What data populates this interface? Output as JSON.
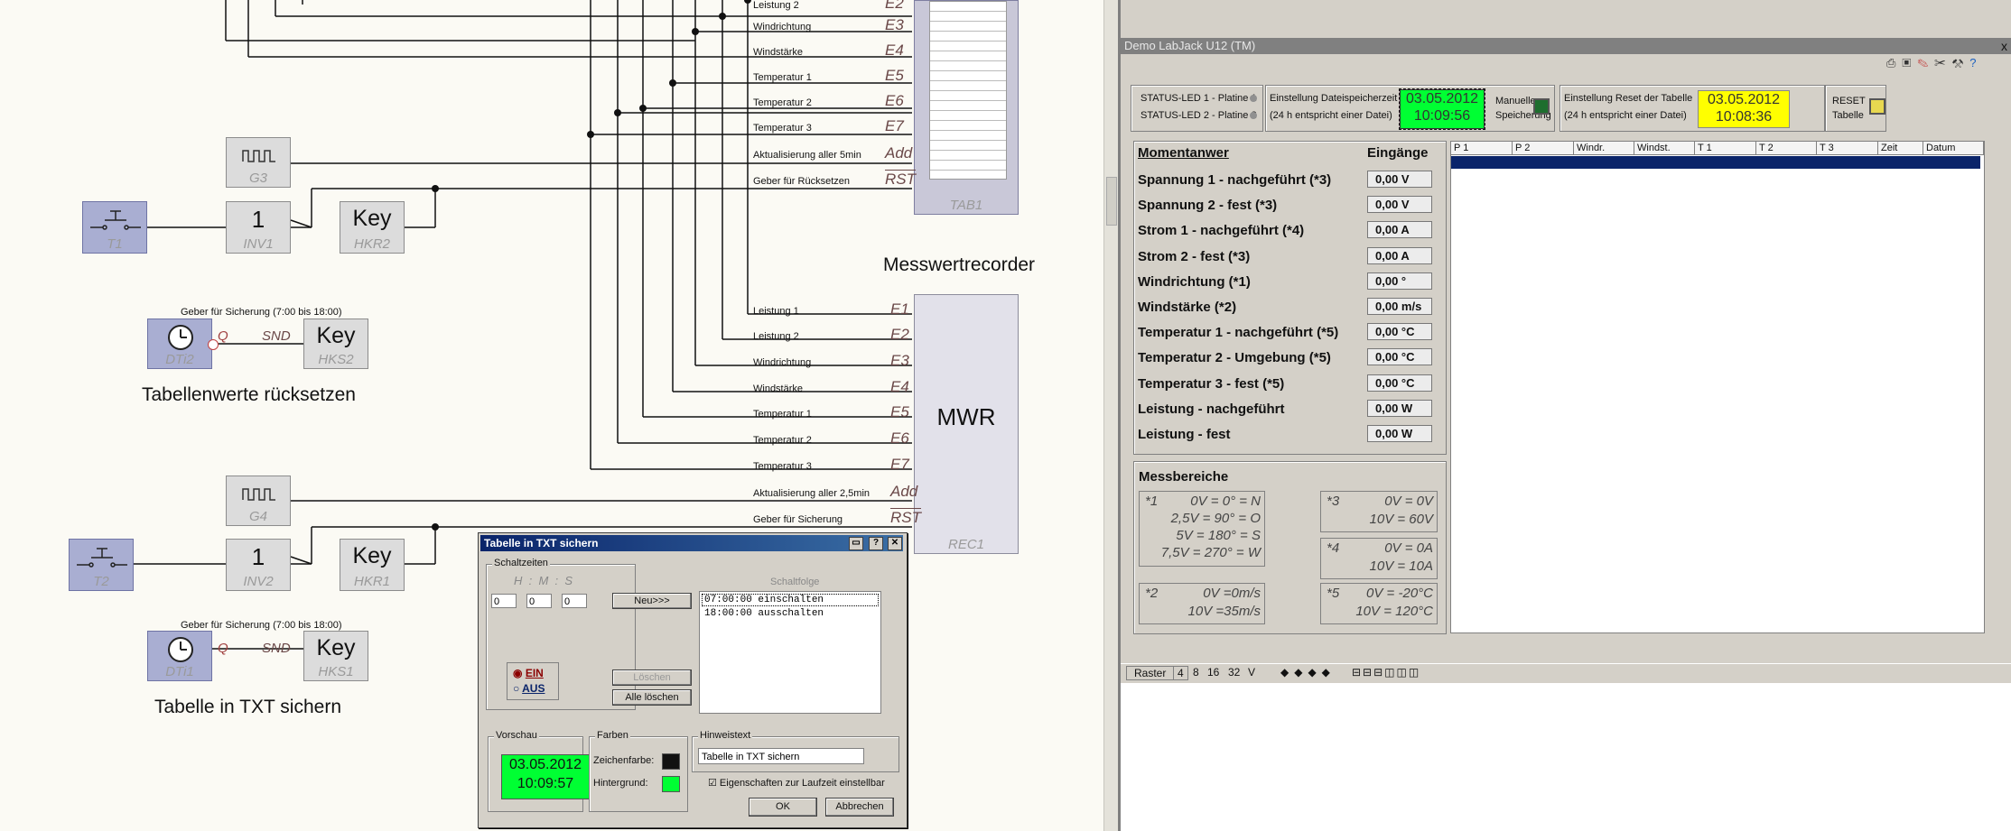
{
  "diagram": {
    "blocks": {
      "g3": {
        "main": "",
        "sub": "G3"
      },
      "t1": {
        "sub": "T1"
      },
      "inv1": {
        "main": "1",
        "sub": "INV1"
      },
      "hkr2": {
        "main": "Key",
        "sub": "HKR2"
      },
      "dti2": {
        "sub": "DTi2"
      },
      "hks2": {
        "main": "Key",
        "sub": "HKS2"
      },
      "g4": {
        "sub": "G4"
      },
      "t2": {
        "sub": "T2"
      },
      "inv2": {
        "main": "1",
        "sub": "INV2"
      },
      "hkr1": {
        "main": "Key",
        "sub": "HKR1"
      },
      "dti1": {
        "sub": "DTi1"
      },
      "hks1": {
        "main": "Key",
        "sub": "HKS1"
      },
      "tab1": {
        "sub": "TAB1"
      },
      "rec1": {
        "main": "MWR",
        "sub": "REC1"
      }
    },
    "captions": {
      "messwertrecorder": "Messwertrecorder",
      "tabellenwerte": "Tabellenwerte  rücksetzen",
      "tabelle_txt": "Tabelle in TXT sichern",
      "geber_sicherung_top": "Geber für Sicherung (7:00 bis 18:00)",
      "geber_sicherung_bottom": "Geber für Sicherung (7:00 bis 18:00)"
    },
    "q_label": "Q",
    "snd_label": "SND",
    "tab_signals": [
      {
        "label": "Leistung 2",
        "pin": "E2"
      },
      {
        "label": "Windrichtung",
        "pin": "E3"
      },
      {
        "label": "Windstärke",
        "pin": "E4"
      },
      {
        "label": "Temperatur 1",
        "pin": "E5"
      },
      {
        "label": "Temperatur 2",
        "pin": "E6"
      },
      {
        "label": "Temperatur 3",
        "pin": "E7"
      },
      {
        "label": "Aktualisierung aller 5min",
        "pin": "Add"
      },
      {
        "label": "Geber für Rücksetzen",
        "pin": "RST"
      }
    ],
    "rec_signals": [
      {
        "label": "Leistung 1",
        "pin": "E1"
      },
      {
        "label": "Leistung 2",
        "pin": "E2"
      },
      {
        "label": "Windrichtung",
        "pin": "E3"
      },
      {
        "label": "Windstärke",
        "pin": "E4"
      },
      {
        "label": "Temperatur 1",
        "pin": "E5"
      },
      {
        "label": "Temperatur 2",
        "pin": "E6"
      },
      {
        "label": "Temperatur 3",
        "pin": "E7"
      },
      {
        "label": "Aktualisierung aller 2,5min",
        "pin": "Add"
      },
      {
        "label": "Geber für Sicherung",
        "pin": "RST"
      }
    ]
  },
  "dialog": {
    "title": "Tabelle in TXT sichern",
    "schaltzeiten_label": "Schaltzeiten",
    "time_header": "H  :  M  :  S",
    "h": "0",
    "m": "0",
    "s": "0",
    "neu": "Neu>>>",
    "schaltfolge_label": "Schaltfolge",
    "schaltfolge": [
      "07:00:00 einschalten",
      "18:00:00 ausschalten"
    ],
    "ein": "EIN",
    "aus": "AUS",
    "loeschen": "Löschen",
    "alle_loeschen": "Alle löschen",
    "vorschau_label": "Vorschau",
    "vorschau_date": "03.05.2012",
    "vorschau_time": "10:09:57",
    "farben_label": "Farben",
    "zeichenfarbe": "Zeichenfarbe:",
    "hintergrund": "Hintergrund:",
    "hinweistext_label": "Hinweistext",
    "hinweistext": "Tabelle in TXT sichern",
    "eigenschaften": "Eigenschaften zur Laufzeit einstellbar",
    "ok": "OK",
    "abbrechen": "Abbrechen"
  },
  "labjack": {
    "title": "Demo LabJack U12 (TM)",
    "close": "x",
    "status_led1": "STATUS-LED 1 - Platine 1",
    "status_led2": "STATUS-LED 2 - Platine 2",
    "einstellung_datei": "Einstellung Dateispeicherzeit",
    "hint_24h": "(24 h entspricht einer Datei)",
    "green_date": "03.05.2012",
    "green_time": "10:09:56",
    "manuelle": "Manuelle",
    "speicherung": "Speicherung",
    "einstellung_reset": "Einstellung Reset der Tabelle",
    "hint_24h_2": "(24 h entspricht einer Datei)",
    "yellow_date": "03.05.2012",
    "yellow_time": "10:08:36",
    "reset": "RESET",
    "tabelle": "Tabelle",
    "momentanwerte": "Momentanwer",
    "eingaenge": "Eingänge",
    "measurements": [
      {
        "label": "Spannung 1 - nachgeführt (*3)",
        "value": "0,00  V"
      },
      {
        "label": "Spannung 2 - fest (*3)",
        "value": "0,00  V"
      },
      {
        "label": "Strom 1 - nachgeführt (*4)",
        "value": "0,00  A"
      },
      {
        "label": "Strom 2 - fest (*3)",
        "value": "0,00  A"
      },
      {
        "label": "Windrichtung (*1)",
        "value": "0,00  °"
      },
      {
        "label": "Windstärke (*2)",
        "value": "0,00  m/s"
      },
      {
        "label": "Temperatur 1 - nachgeführt (*5)",
        "value": "0,00  °C"
      },
      {
        "label": "Temperatur 2 - Umgebung (*5)",
        "value": "0,00  °C"
      },
      {
        "label": "Temperatur 3 - fest (*5)",
        "value": "0,00  °C"
      },
      {
        "label": "Leistung - nachgeführt",
        "value": "0,00  W"
      },
      {
        "label": "Leistung - fest",
        "value": "0,00  W"
      }
    ],
    "messbereiche": "Messbereiche",
    "ranges": {
      "r1": {
        "tag": "*1",
        "lines": [
          "0V = 0° = N",
          "2,5V = 90° = O",
          "5V = 180° = S",
          "7,5V = 270° = W"
        ]
      },
      "r2": {
        "tag": "*2",
        "lines": [
          "0V =0m/s",
          "10V =35m/s"
        ]
      },
      "r3": {
        "tag": "*3",
        "lines": [
          "0V = 0V",
          "10V = 60V"
        ]
      },
      "r4": {
        "tag": "*4",
        "lines": [
          "0V = 0A",
          "10V = 10A"
        ]
      },
      "r5": {
        "tag": "*5",
        "lines": [
          "0V = -20°C",
          "10V = 120°C"
        ]
      }
    },
    "grid_headers": [
      "P 1",
      "P 2",
      "Windr.",
      "Windst.",
      "T 1",
      "T 2",
      "T 3",
      "Zeit",
      "Datum"
    ],
    "statusbar": {
      "raster": "Raster",
      "r4": "4",
      "r8": "8",
      "r16": "16",
      "r32": "32",
      "v": "V"
    }
  },
  "colors": {
    "green": "#00ff33",
    "yellow": "#ffff00",
    "selection": "#0a246a"
  }
}
